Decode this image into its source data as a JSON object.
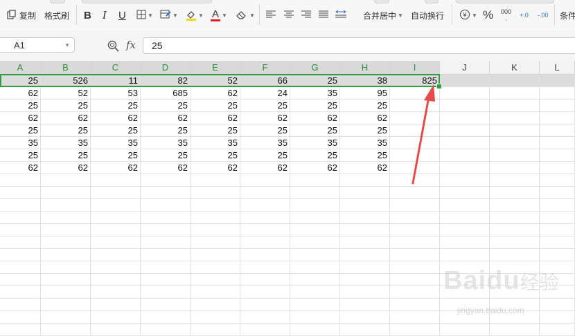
{
  "toolbar": {
    "copy_label": "复制",
    "format_painter_label": "格式刷",
    "bold": "B",
    "italic": "I",
    "underline": "U",
    "font_color_glyph": "A",
    "merge_center_label": "合并居中",
    "auto_wrap_label": "自动换行",
    "percent_glyph": "%",
    "thousands_glyph": "000",
    "inc_decimal_glyph": "+.0",
    "dec_decimal_glyph": "-.00",
    "conditional_label": "条件",
    "accent_color": "#2e9e40",
    "font_color_bar": "#e02020",
    "fill_color_bar": "#f5d800"
  },
  "formula_bar": {
    "name_box": "A1",
    "fx_label": "fx",
    "formula_value": "25"
  },
  "sheet": {
    "columns": [
      "A",
      "B",
      "C",
      "D",
      "E",
      "F",
      "G",
      "H",
      "I",
      "J",
      "K",
      "L"
    ],
    "rows": [
      [
        "25",
        "526",
        "11",
        "82",
        "52",
        "66",
        "25",
        "38",
        "825"
      ],
      [
        "62",
        "52",
        "53",
        "685",
        "62",
        "24",
        "35",
        "95",
        ""
      ],
      [
        "25",
        "25",
        "25",
        "25",
        "25",
        "25",
        "25",
        "25",
        ""
      ],
      [
        "62",
        "62",
        "62",
        "62",
        "62",
        "62",
        "62",
        "62",
        ""
      ],
      [
        "25",
        "25",
        "25",
        "25",
        "25",
        "25",
        "25",
        "25",
        ""
      ],
      [
        "35",
        "35",
        "35",
        "35",
        "35",
        "35",
        "35",
        "35",
        ""
      ],
      [
        "25",
        "25",
        "25",
        "25",
        "25",
        "25",
        "25",
        "25",
        ""
      ],
      [
        "62",
        "62",
        "62",
        "62",
        "62",
        "62",
        "62",
        "62",
        ""
      ]
    ],
    "selected_row": 1,
    "annotation_arrow_color": "#e84a4a"
  },
  "watermark": {
    "brand": "Baidu",
    "brand_cn": "经验",
    "url": "jingyan.baidu.com"
  }
}
